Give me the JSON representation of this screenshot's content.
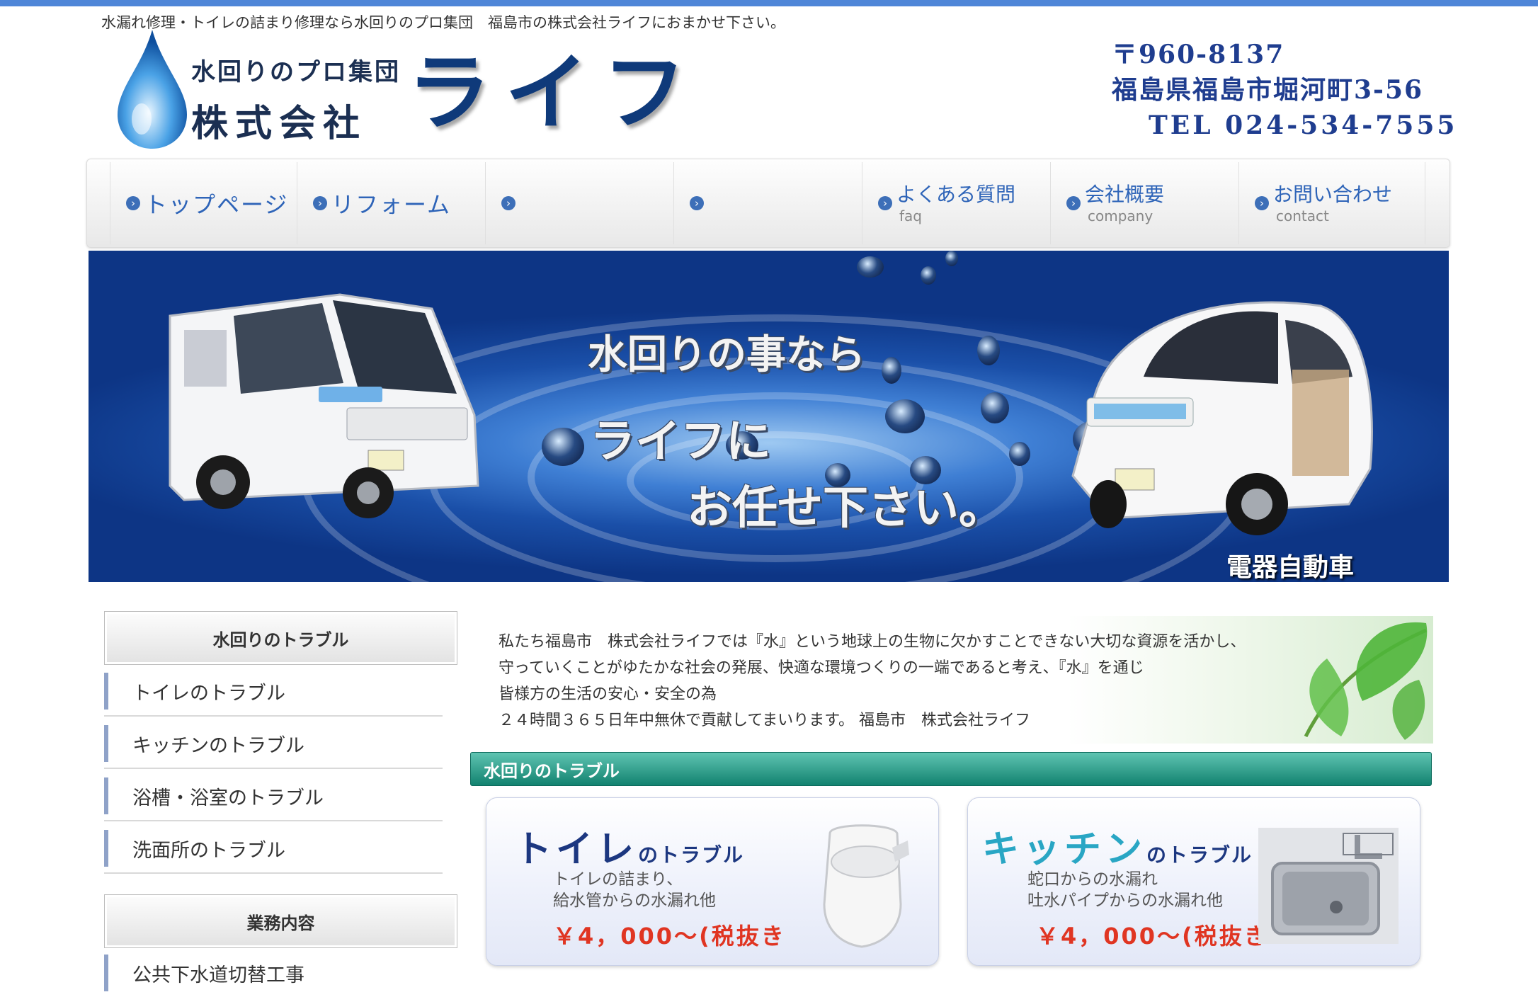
{
  "site": {
    "tagline": "水漏れ修理・トイレの詰まり修理なら水回りのプロ集団　福島市の株式会社ライフにおまかせ下さい。",
    "logo_sub": "水回りのプロ集団",
    "logo_company": "株式会社",
    "logo_name": "ライフ",
    "postal": "〒960-8137",
    "address": "福島県福島市堀河町3-56",
    "tel": "TEL 024-534-7555"
  },
  "nav": {
    "items": [
      {
        "label": "トップページ",
        "sub": ""
      },
      {
        "label": "リフォーム",
        "sub": ""
      },
      {
        "label": "",
        "sub": ""
      },
      {
        "label": "",
        "sub": ""
      },
      {
        "label": "よくある質問",
        "sub": "faq"
      },
      {
        "label": "会社概要",
        "sub": "company"
      },
      {
        "label": "お問い合わせ",
        "sub": "contact"
      }
    ]
  },
  "banner": {
    "line1": "水回りの事なら",
    "line2": "ライフに",
    "line3": "お任せ下さい。",
    "ev_label": "電器自動車"
  },
  "sidebar": {
    "section1": {
      "title": "水回りのトラブル",
      "items": [
        "トイレのトラブル",
        "キッチンのトラブル",
        "浴槽・浴室のトラブル",
        "洗面所のトラブル"
      ]
    },
    "section2": {
      "title": "業務内容",
      "items": [
        "公共下水道切替工事"
      ]
    }
  },
  "main": {
    "intro_lines": [
      "私たち福島市　株式会社ライフでは『水』という地球上の生物に欠かすことできない大切な資源を活かし、",
      "守っていくことがゆたかな社会の発展、快適な環境つくりの一端であると考え、『水』を通じ",
      "皆様方の生活の安心・安全の為",
      "２４時間３６５日年中無休で貢献してまいります。 福島市　株式会社ライフ"
    ],
    "section_title": "水回りのトラブル",
    "cards": [
      {
        "title_big": "トイレ",
        "title_small": "のトラブル",
        "desc": [
          "トイレの詰まり、",
          "給水管からの水漏れ他"
        ],
        "price": "￥4，000～(税抜き"
      },
      {
        "title_big": "キッチン",
        "title_small": "のトラブル",
        "desc": [
          "蛇口からの水漏れ",
          "吐水パイプからの水漏れ他"
        ],
        "price": "￥4，000～(税抜き"
      }
    ]
  }
}
